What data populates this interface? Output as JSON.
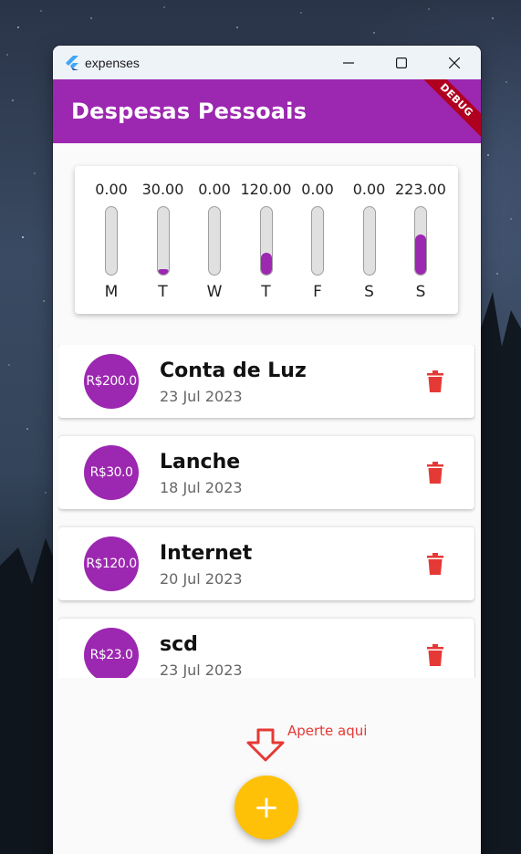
{
  "window": {
    "title": "expenses"
  },
  "appbar": {
    "title": "Despesas Pessoais",
    "debug_label": "DEBUG"
  },
  "colors": {
    "primary": "#9c27b0",
    "accent": "#ffc107",
    "delete": "#e53935"
  },
  "chart_data": {
    "type": "bar",
    "categories": [
      "M",
      "T",
      "W",
      "T",
      "F",
      "S",
      "S"
    ],
    "values": [
      0.0,
      30.0,
      0.0,
      120.0,
      0.0,
      0.0,
      223.0
    ],
    "value_labels": [
      "0.00",
      "30.00",
      "0.00",
      "120.00",
      "0.00",
      "0.00",
      "223.00"
    ],
    "max": 373.0
  },
  "transactions": [
    {
      "value_label": "R$200.0",
      "title": "Conta de Luz",
      "date": "23 Jul 2023",
      "icon": "trash-icon"
    },
    {
      "value_label": "R$30.0",
      "title": "Lanche",
      "date": "18 Jul 2023",
      "icon": "trash-icon"
    },
    {
      "value_label": "R$120.0",
      "title": "Internet",
      "date": "20 Jul 2023",
      "icon": "trash-icon"
    },
    {
      "value_label": "R$23.0",
      "title": "scd",
      "date": "23 Jul 2023",
      "icon": "trash-icon"
    }
  ],
  "annotation": {
    "text": "Aperte aqui"
  },
  "fab": {
    "label": "+"
  }
}
